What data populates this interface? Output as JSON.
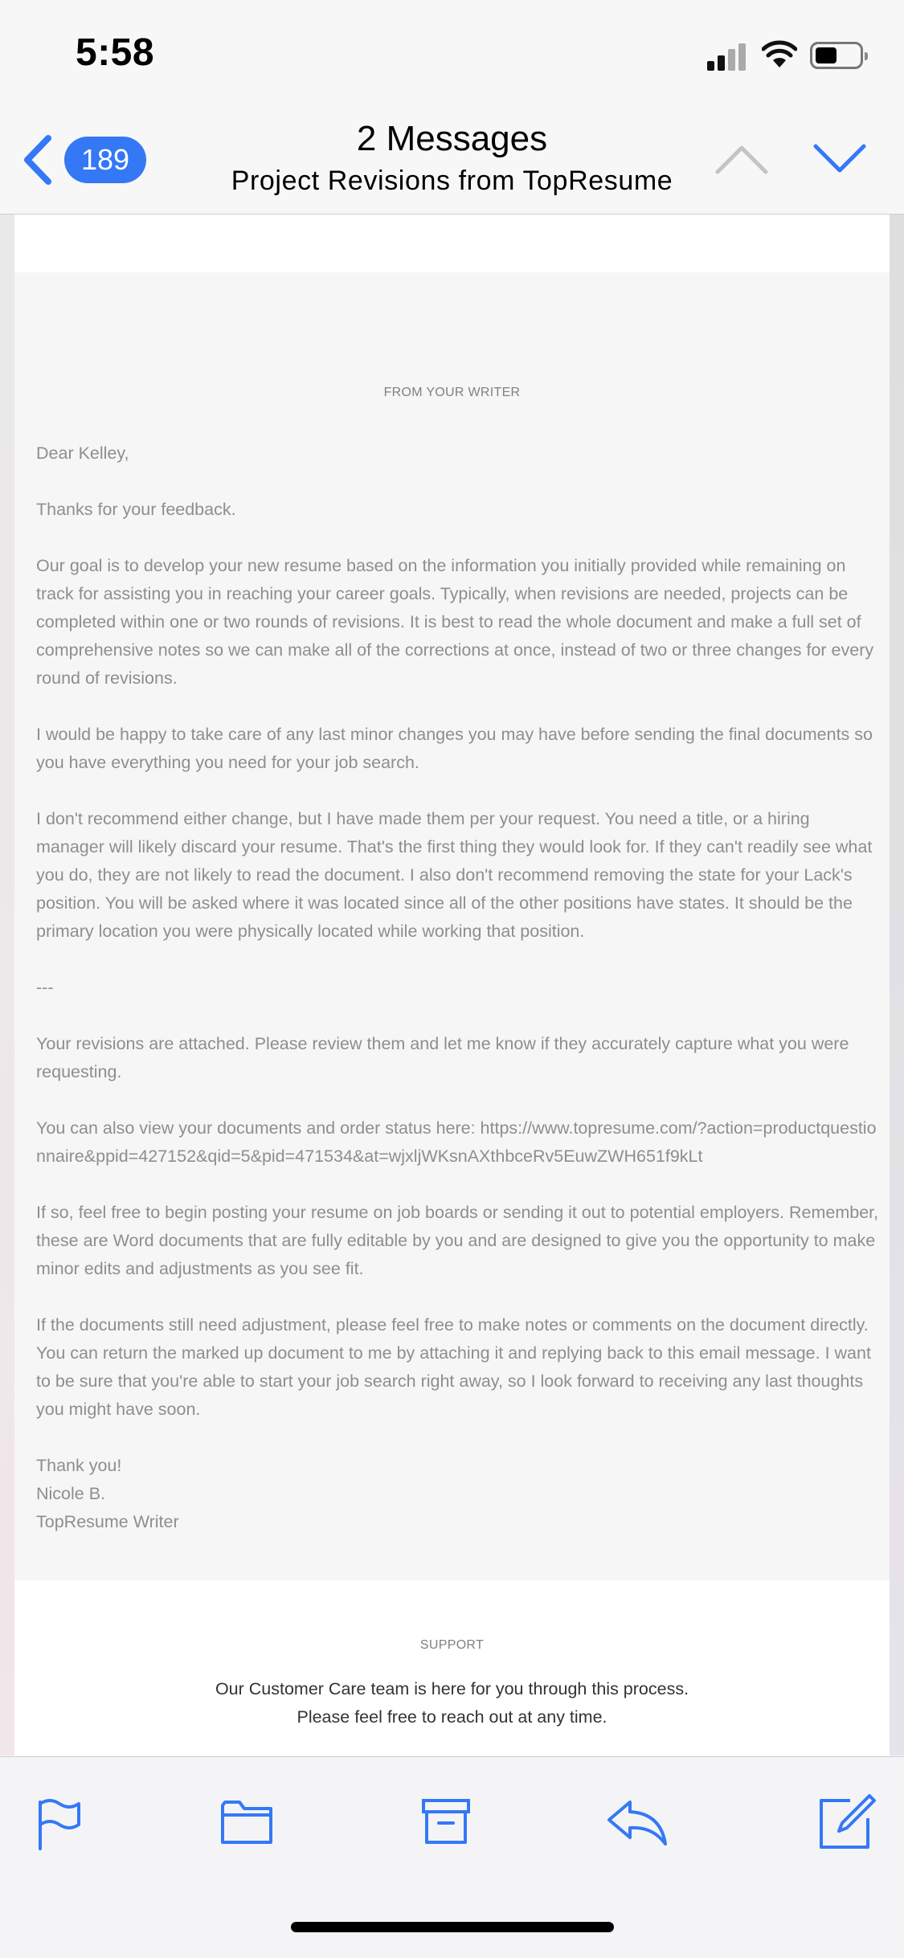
{
  "status_bar": {
    "time": "5:58"
  },
  "nav": {
    "unread_count": "189",
    "title": "2 Messages",
    "subtitle": "Project Revisions from TopResume"
  },
  "email": {
    "section_label": "FROM YOUR WRITER",
    "greeting": "Dear Kelley,",
    "paragraphs": [
      "Thanks for your feedback.",
      "Our goal is to develop your new resume based on the information you initially provided while remaining on track for assisting you in reaching your career goals. Typically, when revisions are needed, projects can be completed within one or two rounds of revisions. It is best to read the whole document and make a full set of comprehensive notes so we can make all of the corrections at once, instead of two or three changes for every round of revisions.",
      "I would be happy to take care of any last minor changes you may have before sending the final documents so you have everything you need for your job search.",
      "I don't recommend either change, but I have made them per your request. You need a title, or a hiring manager will likely discard your resume. That's the first thing they would look for. If they can't readily see what you do, they are not likely to read the document. I also don't recommend removing the state for your Lack's position. You will be asked where it was located since all of the other positions have states. It should be the primary location you were physically located while working that position.",
      "---",
      "Your revisions are attached. Please review them and let me know if they accurately capture what you were requesting.",
      "You can also view your documents and order status here: https://www.topresume.com/?action=productquestionnaire&ppid=427152&qid=5&pid=471534&at=wjxljWKsnAXthbceRv5EuwZWH651f9kLt",
      "If so, feel free to begin posting your resume on job boards or sending it out to potential employers. Remember, these are Word documents that are fully editable by you and are designed to give you the opportunity to make minor edits and adjustments as you see fit.",
      "If the documents still need adjustment, please feel free to make notes or comments on the document directly. You can return the marked up document to me by attaching it and replying back to this email message. I want to be sure that you're able to start your job search right away, so I look forward to receiving any last thoughts you might have soon."
    ],
    "signoff": [
      "Thank you!",
      "Nicole B.",
      "TopResume Writer"
    ],
    "support": {
      "label": "SUPPORT",
      "line1": "Our Customer Care team is here for you through this process.",
      "line2": "Please feel free to reach out at any time."
    }
  },
  "toolbar": {
    "icons": [
      "flag-icon",
      "folder-icon",
      "archive-icon",
      "reply-icon",
      "compose-icon"
    ]
  },
  "colors": {
    "accent": "#3478f6",
    "body_text": "#8e8e8e"
  }
}
